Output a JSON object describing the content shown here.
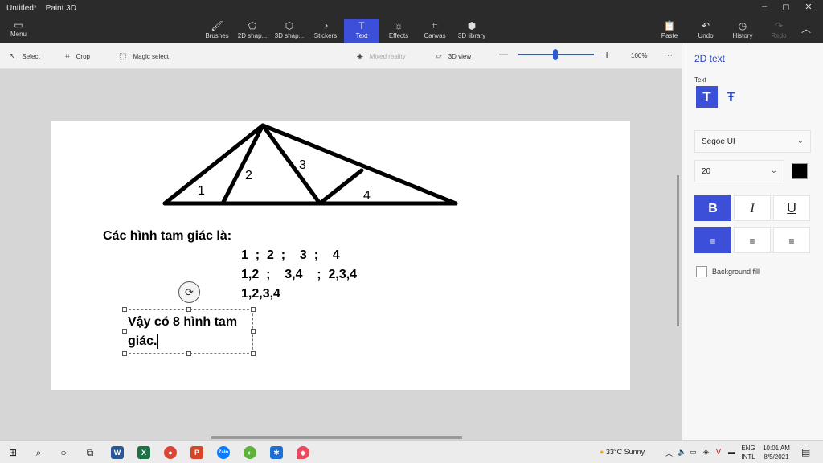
{
  "window": {
    "title": "Untitled*",
    "app_name": "Paint 3D",
    "min": "–",
    "max": "◻",
    "close": "✕"
  },
  "ribbon": {
    "menu_label": "Menu",
    "tools": [
      {
        "label": "Brushes"
      },
      {
        "label": "2D shap..."
      },
      {
        "label": "3D shap..."
      },
      {
        "label": "Stickers"
      },
      {
        "label": "Text"
      },
      {
        "label": "Effects"
      },
      {
        "label": "Canvas"
      },
      {
        "label": "3D library"
      }
    ],
    "right": [
      {
        "label": "Paste"
      },
      {
        "label": "Undo"
      },
      {
        "label": "History"
      },
      {
        "label": "Redo"
      }
    ]
  },
  "toolbar": {
    "select": "Select",
    "crop": "Crop",
    "magic_select": "Magic select",
    "mixed_reality": "Mixed reality",
    "view_3d": "3D view",
    "zoom_minus": "—",
    "zoom_plus": "+",
    "zoom": "100%",
    "more": "···"
  },
  "canvas": {
    "labels": [
      "1",
      "2",
      "3",
      "4"
    ],
    "heading": "Các hình tam giác là:",
    "line1": "1  ;  2  ;    3  ;    4",
    "line2": "1,2  ;    3,4    ;  2,3,4",
    "line3": "1,2,3,4",
    "textbox_line1": "Vậy có 8 hình tam",
    "textbox_line2": "giác."
  },
  "panel": {
    "title": "2D text",
    "text_label": "Text",
    "font": "Segoe UI",
    "size": "20",
    "bold": "B",
    "italic": "I",
    "underline": "U",
    "color": "#000000",
    "background_fill": "Background fill"
  },
  "taskbar": {
    "weather": "33°C  Sunny",
    "lang1": "ENG",
    "lang2": "INTL",
    "time": "10:01 AM",
    "date": "8/5/2021"
  }
}
